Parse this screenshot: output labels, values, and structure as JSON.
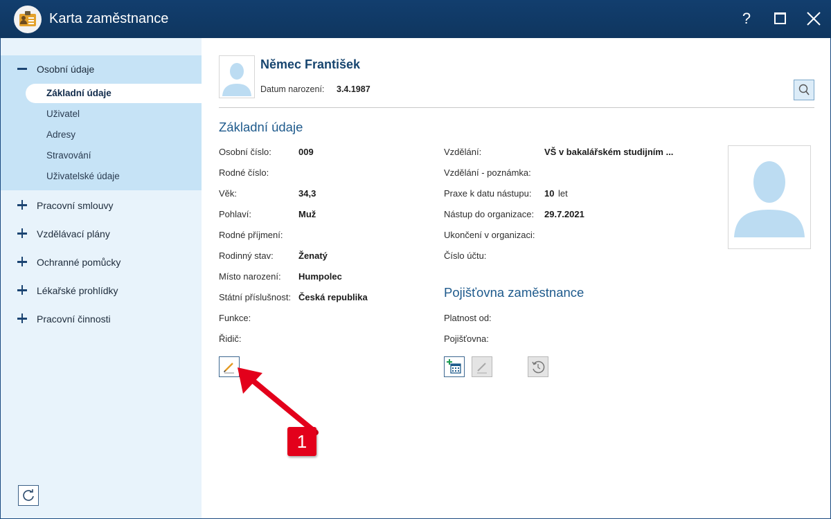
{
  "window": {
    "title": "Karta zaměstnance",
    "help_symbol": "?"
  },
  "sidebar": {
    "groups": [
      {
        "label": "Osobní údaje",
        "expanded": true,
        "items": [
          {
            "label": "Základní údaje",
            "active": true
          },
          {
            "label": "Uživatel"
          },
          {
            "label": "Adresy"
          },
          {
            "label": "Stravování"
          },
          {
            "label": "Uživatelské údaje"
          }
        ]
      },
      {
        "label": "Pracovní smlouvy"
      },
      {
        "label": "Vzdělávací plány"
      },
      {
        "label": "Ochranné pomůcky"
      },
      {
        "label": "Lékařské prohlídky"
      },
      {
        "label": "Pracovní činnosti"
      }
    ]
  },
  "employee": {
    "name": "Němec František",
    "dob_label": "Datum narození:",
    "dob_value": "3.4.1987"
  },
  "basic": {
    "title": "Základní údaje",
    "left_fields": [
      {
        "label": "Osobní číslo:",
        "value": "009"
      },
      {
        "label": "Rodné číslo:",
        "value": ""
      },
      {
        "label": "Věk:",
        "value": "34,3"
      },
      {
        "label": "Pohlaví:",
        "value": "Muž"
      },
      {
        "label": "Rodné příjmení:",
        "value": ""
      },
      {
        "label": "Rodinný stav:",
        "value": "Ženatý"
      },
      {
        "label": "Místo narození:",
        "value": "Humpolec"
      },
      {
        "label": "Státní příslušnost:",
        "value": "Česká republika"
      },
      {
        "label": "Funkce:",
        "value": ""
      },
      {
        "label": "Řidič:",
        "value": ""
      }
    ],
    "right_fields": [
      {
        "label": "Vzdělání:",
        "value": "VŠ v bakalářském studijním ..."
      },
      {
        "label": "Vzdělání - poznámka:",
        "value": ""
      },
      {
        "label": "Praxe k datu nástupu:",
        "value": "10",
        "unit": "let"
      },
      {
        "label": "Nástup do organizace:",
        "value": "29.7.2021"
      },
      {
        "label": "Ukončení v organizaci:",
        "value": ""
      },
      {
        "label": "Číslo účtu:",
        "value": ""
      }
    ]
  },
  "insurance": {
    "title": "Pojišťovna zaměstnance",
    "fields": [
      {
        "label": "Platnost od:",
        "value": ""
      },
      {
        "label": "Pojišťovna:",
        "value": ""
      }
    ]
  },
  "callout": {
    "number": "1"
  },
  "colors": {
    "titlebar": "#123e6e",
    "sidebar": "#e8f3fb",
    "sidebar_selected_group": "#c6e3f6",
    "accent": "#1e5a8c",
    "callout": "#e3001b"
  }
}
